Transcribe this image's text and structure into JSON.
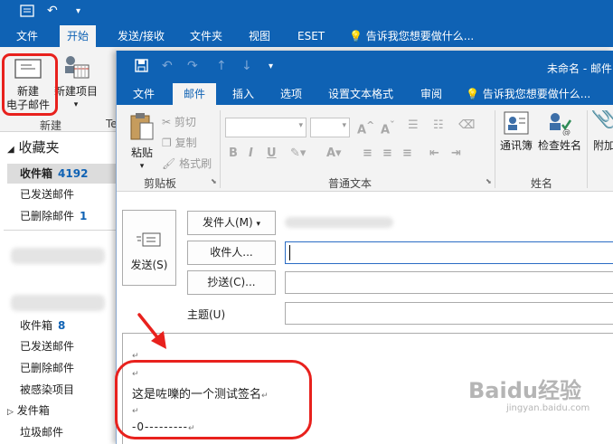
{
  "outer": {
    "tabs": [
      "文件",
      "开始",
      "发送/接收",
      "文件夹",
      "视图",
      "ESET",
      "告诉我您想要做什么..."
    ],
    "ribbon": {
      "new_email_line1": "新建",
      "new_email_line2": "电子邮件",
      "new_items": "新建项目",
      "group_new": "新建",
      "group_cut_letter": "Te"
    }
  },
  "nav": {
    "favorites": "收藏夹",
    "inbox": "收件箱",
    "inbox_count": "4192",
    "sent": "已发送邮件",
    "deleted": "已删除邮件",
    "deleted_count": "1",
    "inbox2": "收件箱",
    "inbox2_count": "8",
    "sent2": "已发送邮件",
    "deleted2": "已删除邮件",
    "infected": "被感染项目",
    "outbox": "发件箱",
    "junk": "垃圾邮件"
  },
  "compose": {
    "title": "未命名 - 邮件",
    "tabs": [
      "文件",
      "邮件",
      "插入",
      "选项",
      "设置文本格式",
      "审阅",
      "告诉我您想要做什么..."
    ],
    "clipboard": {
      "paste": "粘贴",
      "cut": "剪切",
      "copy": "复制",
      "format_painter": "格式刷",
      "group": "剪贴板"
    },
    "basic_text_group": "普通文本",
    "names": {
      "address_book": "通讯簿",
      "check_names": "检查姓名",
      "group": "姓名",
      "attach": "附加"
    },
    "send": "发送(S)",
    "from": "发件人(M)",
    "to": "收件人...",
    "cc": "抄送(C)...",
    "subject": "主题(U)",
    "body_line1": "这是咗嚛的一个测试签名",
    "signature_line": "-0---------"
  },
  "watermark": {
    "brand": "Baidu经验",
    "url": "jingyan.baidu.com"
  },
  "colors": {
    "accent": "#0f62b4",
    "highlight": "#e8211d"
  }
}
